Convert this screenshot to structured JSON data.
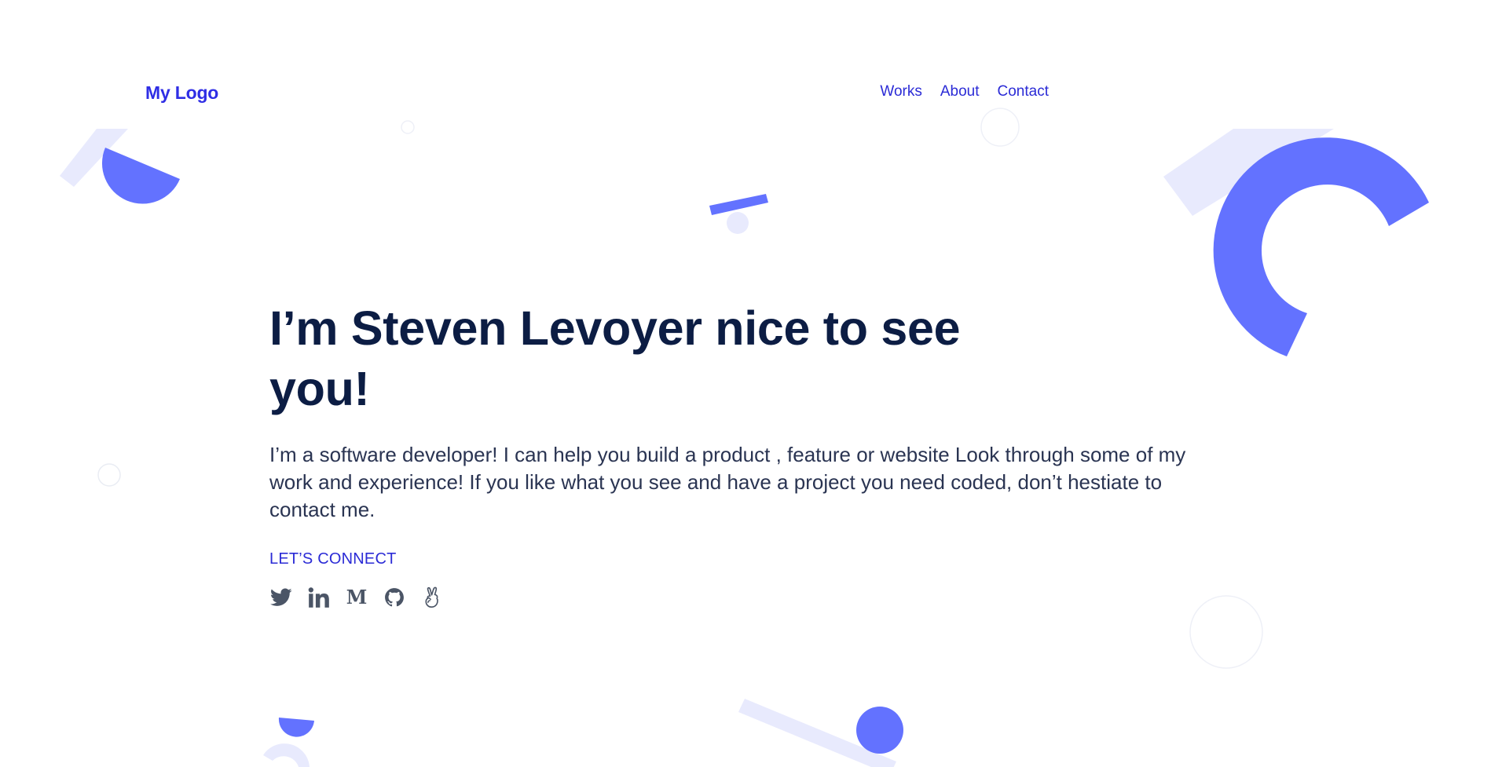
{
  "header": {
    "logo": "My Logo",
    "nav": [
      {
        "label": "Works"
      },
      {
        "label": "About"
      },
      {
        "label": "Contact"
      }
    ]
  },
  "hero": {
    "title": "I’m Steven Levoyer nice to see you!",
    "description": "I’m a software developer! I can help you build a product , feature or website Look through some of my work and experience! If you like what you see and have a project you need coded, don’t hestiate to contact me.",
    "connect_label": "LET’S CONNECT",
    "socials": [
      "twitter-icon",
      "linkedin-icon",
      "medium-icon",
      "github-icon",
      "angellist-icon"
    ],
    "medium_letter": "M",
    "linkedin_letters": "in"
  },
  "colors": {
    "accent": "#6372ff",
    "accent_light": "#e8eafd",
    "brand_text": "#2f2ee5",
    "heading": "#0c1d44",
    "body_text": "#2a3452",
    "icon": "#4b5566"
  }
}
